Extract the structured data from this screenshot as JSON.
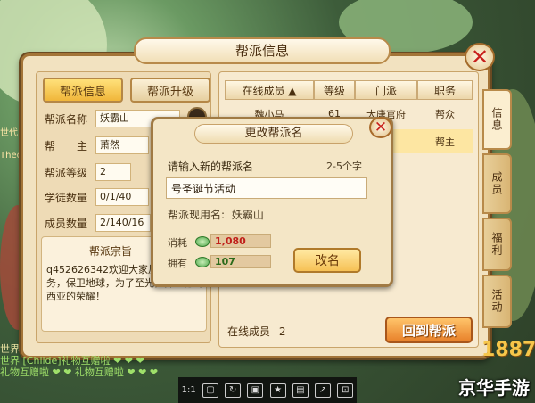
{
  "window": {
    "title": "帮派信息"
  },
  "left": {
    "tabs": [
      "帮派信息",
      "帮派升级"
    ],
    "fields": [
      {
        "label": "帮派名称",
        "value": "妖霸山"
      },
      {
        "label": "帮　　主",
        "value": "萧然"
      },
      {
        "label": "帮派等级",
        "value": "2"
      },
      {
        "label": "学徒数量",
        "value": "0/1/40"
      },
      {
        "label": "成员数量",
        "value": "2/140/16"
      }
    ],
    "motto_title": "帮派宗旨",
    "motto_text": "q452626342欢迎大家加入帮派任务，保卫地球，为了至光，捍卫德玛西亚的荣耀！"
  },
  "table": {
    "headers": [
      "在线成员 ▲",
      "等级",
      "门派",
      "职务"
    ],
    "rows": [
      {
        "name": "魏小马",
        "level": "61",
        "school": "大唐官府",
        "role": "帮众"
      },
      {
        "name": "",
        "level": "",
        "school": "府",
        "role": "帮主"
      }
    ],
    "online_label": "在线成员",
    "online_count": "2",
    "back_button": "回到帮派"
  },
  "side_tabs": [
    "信息",
    "成员",
    "福利",
    "活动"
  ],
  "dialog": {
    "title": "更改帮派名",
    "prompt": "请输入新的帮派名",
    "hint": "2-5个字",
    "input_value": "号圣诞节活动",
    "current_label": "帮派现用名:",
    "current_name": "妖霸山",
    "cost_label": "消耗",
    "cost_value": "1,080",
    "owned_label": "拥有",
    "owned_value": "107",
    "rename_button": "改名"
  },
  "chat": [
    {
      "channel": "世界",
      "text": "世界"
    },
    {
      "channel": "世界",
      "text": "世界 [Childe]礼物互赠啦 ❤ ❤ ❤"
    },
    {
      "channel": "",
      "text": "礼物互赠啦 ❤ ❤ 礼物互赠啦 ❤ ❤ ❤"
    }
  ],
  "side_left": [
    "世代",
    "Theon"
  ],
  "toolbar": [
    "1:1",
    "▢",
    "↻",
    "▣",
    "★",
    "▤",
    "↗",
    "⊡"
  ],
  "watermark": "京华手游",
  "corner_logo": "1887",
  "colors": {
    "accent": "#f0b63a",
    "close": "#c8201c",
    "cost": "#c0201a",
    "owned": "#2a6a1a"
  }
}
